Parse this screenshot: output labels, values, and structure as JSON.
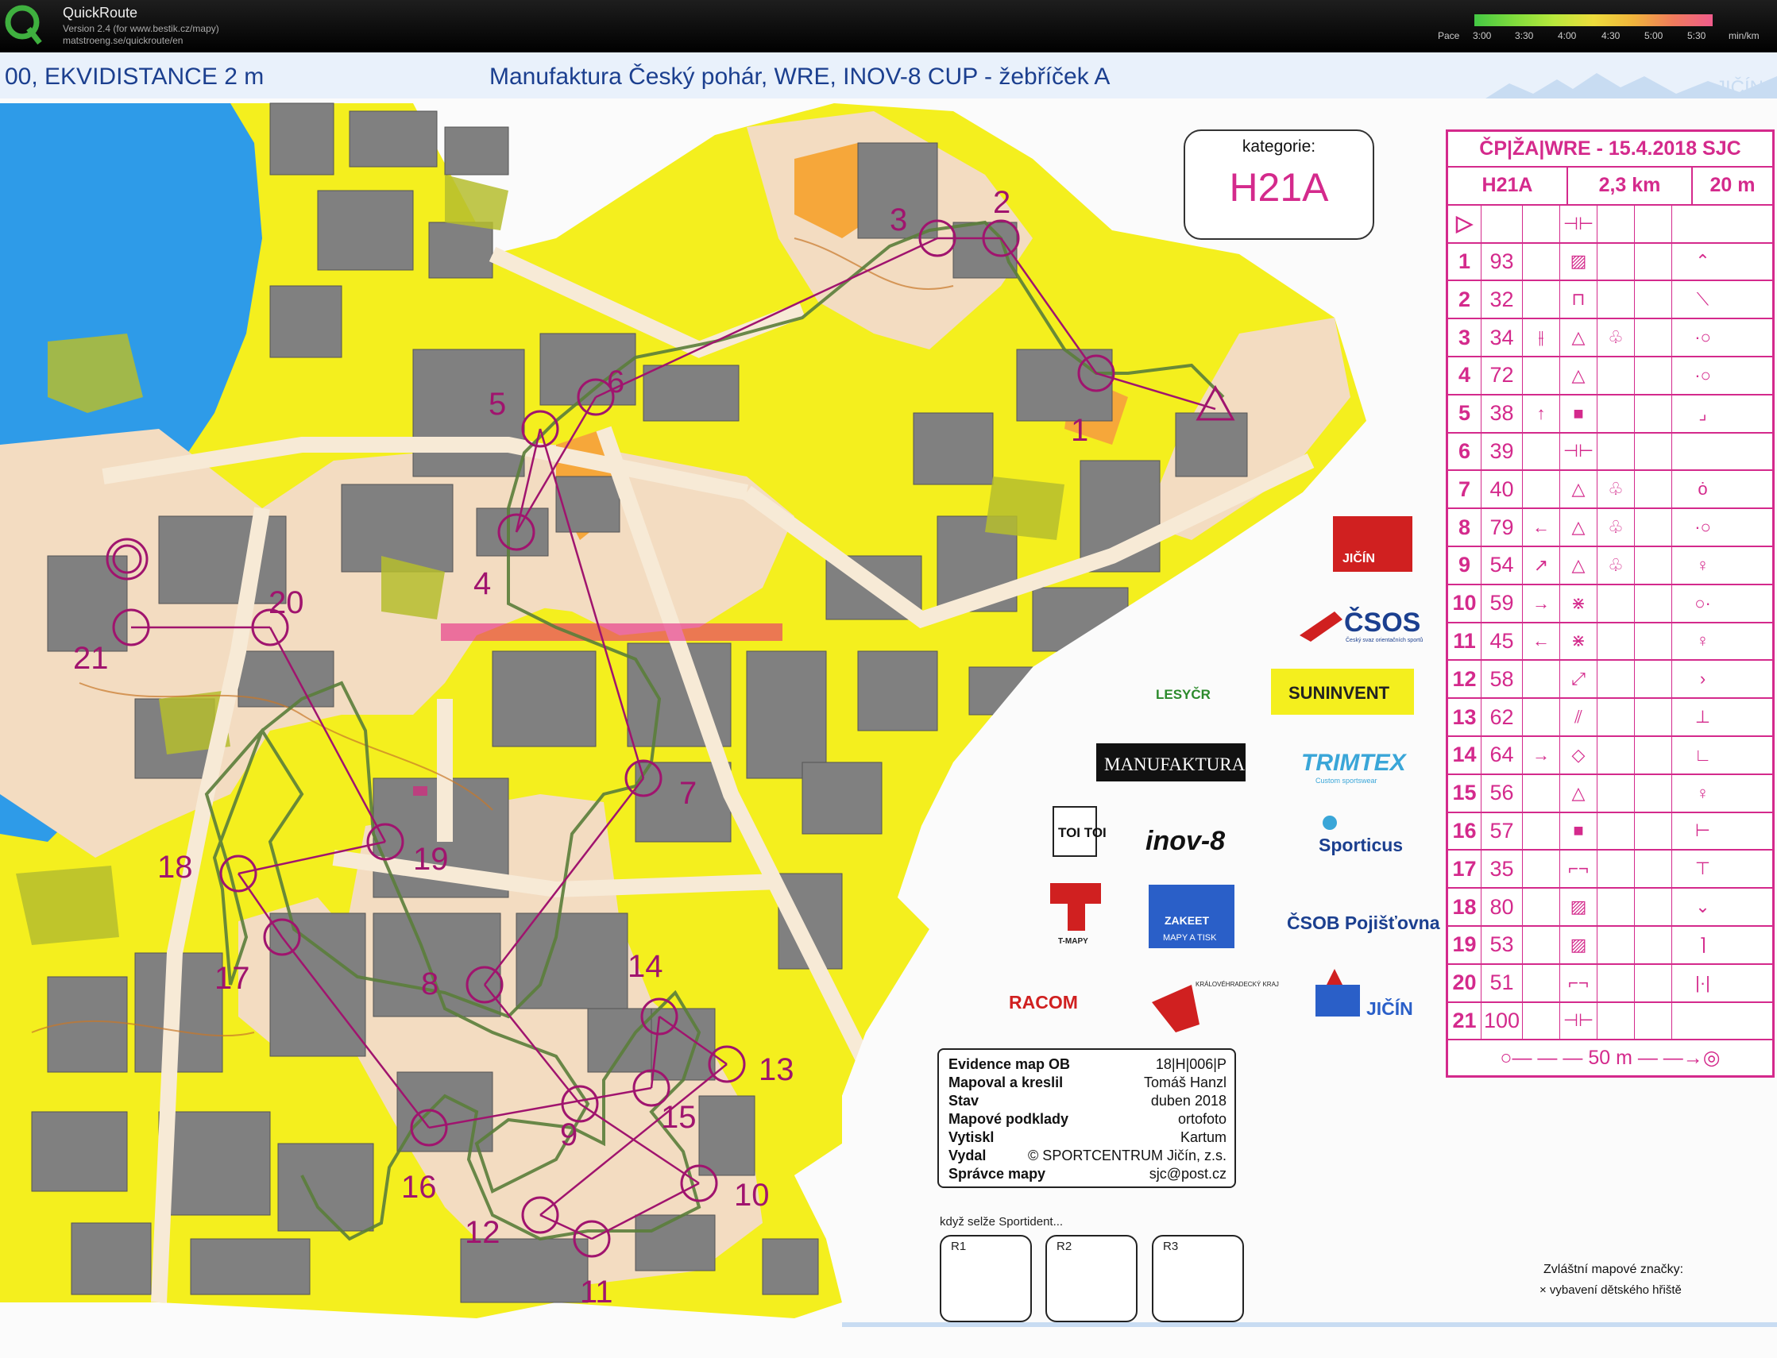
{
  "app": {
    "name": "QuickRoute",
    "version": "Version 2.4  (for www.bestik.cz/mapy)",
    "url": "matstroeng.se/quickroute/en",
    "pace_label": "Pace",
    "pace_ticks": [
      "3:00",
      "3:30",
      "4:00",
      "4:30",
      "5:00",
      "5:30"
    ],
    "pace_unit": "min/km"
  },
  "map": {
    "header_left": "00, EKVIDISTANCE 2 m",
    "header_center": "Manufaktura Český pohár, WRE, INOV-8 CUP - žebříček A",
    "corner_brand": "JIČÍN",
    "category_label": "kategorie:",
    "category": "H21A",
    "colors": {
      "water": "#2e9be8",
      "open_land": "#f6f200",
      "rough_open": "#f8d88a",
      "building": "#7f7f7f",
      "paved": "#f3dcc1",
      "course": "#b0146e",
      "route": "#5a7d3a"
    },
    "controls": [
      {
        "label": "1"
      },
      {
        "label": "2"
      },
      {
        "label": "3"
      },
      {
        "label": "4"
      },
      {
        "label": "5"
      },
      {
        "label": "6"
      },
      {
        "label": "7"
      },
      {
        "label": "8"
      },
      {
        "label": "9"
      },
      {
        "label": "10"
      },
      {
        "label": "11"
      },
      {
        "label": "12"
      },
      {
        "label": "13"
      },
      {
        "label": "14"
      },
      {
        "label": "15"
      },
      {
        "label": "16"
      },
      {
        "label": "17"
      },
      {
        "label": "18"
      },
      {
        "label": "19"
      },
      {
        "label": "20"
      },
      {
        "label": "21"
      }
    ]
  },
  "sponsors": {
    "club": "JIČÍN",
    "csos": "ČSOS",
    "csos_sub": "Český svaz orientačních sportů",
    "lesycr": "LESYČR",
    "suninvent": "SUNINVENT",
    "manufaktura": "MANUFAKTURA",
    "trimtex": "TRIMTEX",
    "trimtex_sub": "Custom sportswear",
    "toitoi": "TOI TOI",
    "inov8": "inov-8",
    "sporticus": "Sporticus",
    "tmapy": "T-MAPY",
    "zakeet": "ZAKEET",
    "zakeet_sub": "MAPY A TISK",
    "csob": "ČSOB Pojišťovna",
    "racom": "RACOM",
    "kraj": "KRÁLOVÉHRADECKÝ KRAJ",
    "jicin_city": "JIČÍN"
  },
  "description": {
    "title": "ČP|ŽA|WRE - 15.4.2018 SJC",
    "category": "H21A",
    "length": "2,3 km",
    "climb": "20 m",
    "start_symbol": "▷",
    "start_feature": "⊣⊢",
    "rows": [
      {
        "num": "1",
        "code": "93",
        "dir": "",
        "feature": "▨",
        "g": "",
        "h": "⌃"
      },
      {
        "num": "2",
        "code": "32",
        "dir": "",
        "feature": "⊓",
        "g": "",
        "h": "⟍"
      },
      {
        "num": "3",
        "code": "34",
        "dir": "⫲",
        "feature": "△",
        "g": "♧",
        "h": "·○"
      },
      {
        "num": "4",
        "code": "72",
        "dir": "",
        "feature": "△",
        "g": "",
        "h": "·○"
      },
      {
        "num": "5",
        "code": "38",
        "dir": "↑",
        "feature": "■",
        "g": "",
        "h": "⌟"
      },
      {
        "num": "6",
        "code": "39",
        "dir": "",
        "feature": "⊣⊢",
        "g": "",
        "h": ""
      },
      {
        "num": "7",
        "code": "40",
        "dir": "",
        "feature": "△",
        "g": "♧",
        "h": "ȯ"
      },
      {
        "num": "8",
        "code": "79",
        "dir": "←",
        "feature": "△",
        "g": "♧",
        "h": "·○"
      },
      {
        "num": "9",
        "code": "54",
        "dir": "↗",
        "feature": "△",
        "g": "♧",
        "h": "♀"
      },
      {
        "num": "10",
        "code": "59",
        "dir": "→",
        "feature": "⋇",
        "g": "",
        "h": "○·"
      },
      {
        "num": "11",
        "code": "45",
        "dir": "←",
        "feature": "⋇",
        "g": "",
        "h": "♀"
      },
      {
        "num": "12",
        "code": "58",
        "dir": "",
        "feature": "⤢",
        "g": "",
        "h": "›"
      },
      {
        "num": "13",
        "code": "62",
        "dir": "",
        "feature": "⫽",
        "g": "",
        "h": "⊥"
      },
      {
        "num": "14",
        "code": "64",
        "dir": "→",
        "feature": "◇",
        "g": "",
        "h": "∟"
      },
      {
        "num": "15",
        "code": "56",
        "dir": "",
        "feature": "△",
        "g": "",
        "h": "♀"
      },
      {
        "num": "16",
        "code": "57",
        "dir": "",
        "feature": "■",
        "g": "",
        "h": "⊢"
      },
      {
        "num": "17",
        "code": "35",
        "dir": "",
        "feature": "⌐¬",
        "g": "",
        "h": "⊤"
      },
      {
        "num": "18",
        "code": "80",
        "dir": "",
        "feature": "▨",
        "g": "",
        "h": "⌄"
      },
      {
        "num": "19",
        "code": "53",
        "dir": "",
        "feature": "▨",
        "g": "",
        "h": "⌉"
      },
      {
        "num": "20",
        "code": "51",
        "dir": "",
        "feature": "⌐¬",
        "g": "",
        "h": "|·|"
      },
      {
        "num": "21",
        "code": "100",
        "dir": "",
        "feature": "⊣⊢",
        "g": "",
        "h": ""
      }
    ],
    "finish": "○— — —  50 m  — —→◎"
  },
  "info": {
    "rows": [
      {
        "k": "Evidence map OB",
        "v": "18|H|006|P"
      },
      {
        "k": "Mapoval a kreslil",
        "v": "Tomáš Hanzl"
      },
      {
        "k": "Stav",
        "v": "duben 2018"
      },
      {
        "k": "Mapové podklady",
        "v": "ortofoto"
      },
      {
        "k": "Vytiskl",
        "v": "Kartum"
      },
      {
        "k": "Vydal",
        "v": "© SPORTCENTRUM Jičín, z.s."
      },
      {
        "k": "Správce mapy",
        "v": "sjc@post.cz"
      }
    ]
  },
  "si_backup": {
    "note": "když selže Sportident...",
    "boxes": [
      "R1",
      "R2",
      "R3"
    ]
  },
  "special_symbols": {
    "title": "Zvláštní mapové značky:",
    "item": "× vybavení dětského hřiště"
  }
}
